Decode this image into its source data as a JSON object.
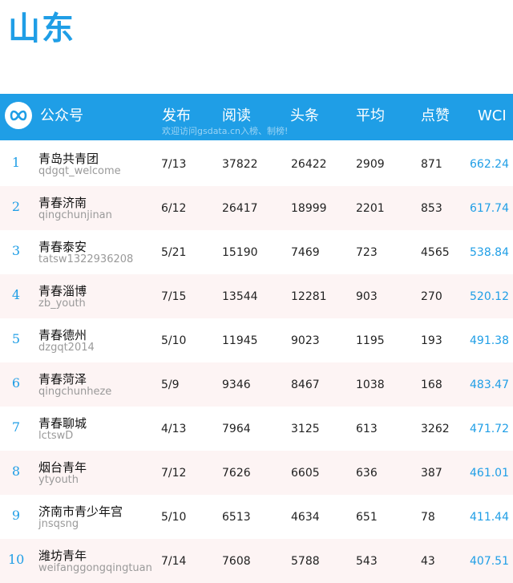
{
  "title": "山东",
  "header": {
    "account": "公众号",
    "publish": "发布",
    "reads": "阅读",
    "headline": "头条",
    "average": "平均",
    "likes": "点赞",
    "wci": "WCI",
    "note": "欢迎访问gsdata.cn入榜、制榜!"
  },
  "colors": {
    "accent": "#1f9ee6",
    "alt_row": "#fdf4f4"
  },
  "rows": [
    {
      "rank": "1",
      "name": "青岛共青团",
      "account": "qdgqt_welcome",
      "publish": "7/13",
      "reads": "37822",
      "headline": "26422",
      "average": "2909",
      "likes": "871",
      "wci": "662.24"
    },
    {
      "rank": "2",
      "name": "青春济南",
      "account": "qingchunjinan",
      "publish": "6/12",
      "reads": "26417",
      "headline": "18999",
      "average": "2201",
      "likes": "853",
      "wci": "617.74"
    },
    {
      "rank": "3",
      "name": "青春泰安",
      "account": "tatsw1322936208",
      "publish": "5/21",
      "reads": "15190",
      "headline": "7469",
      "average": "723",
      "likes": "4565",
      "wci": "538.84"
    },
    {
      "rank": "4",
      "name": "青春淄博",
      "account": "zb_youth",
      "publish": "7/15",
      "reads": "13544",
      "headline": "12281",
      "average": "903",
      "likes": "270",
      "wci": "520.12"
    },
    {
      "rank": "5",
      "name": "青春德州",
      "account": "dzgqt2014",
      "publish": "5/10",
      "reads": "11945",
      "headline": "9023",
      "average": "1195",
      "likes": "193",
      "wci": "491.38"
    },
    {
      "rank": "6",
      "name": "青春菏泽",
      "account": "qingchunheze",
      "publish": "5/9",
      "reads": "9346",
      "headline": "8467",
      "average": "1038",
      "likes": "168",
      "wci": "483.47"
    },
    {
      "rank": "7",
      "name": "青春聊城",
      "account": "lctswD",
      "publish": "4/13",
      "reads": "7964",
      "headline": "3125",
      "average": "613",
      "likes": "3262",
      "wci": "471.72"
    },
    {
      "rank": "8",
      "name": "烟台青年",
      "account": "ytyouth",
      "publish": "7/12",
      "reads": "7626",
      "headline": "6605",
      "average": "636",
      "likes": "387",
      "wci": "461.01"
    },
    {
      "rank": "9",
      "name": "济南市青少年宫",
      "account": "jnsqsng",
      "publish": "5/10",
      "reads": "6513",
      "headline": "4634",
      "average": "651",
      "likes": "78",
      "wci": "411.44"
    },
    {
      "rank": "10",
      "name": "潍坊青年",
      "account": "weifanggongqingtuan",
      "publish": "7/14",
      "reads": "7608",
      "headline": "5788",
      "average": "543",
      "likes": "43",
      "wci": "407.51"
    }
  ]
}
